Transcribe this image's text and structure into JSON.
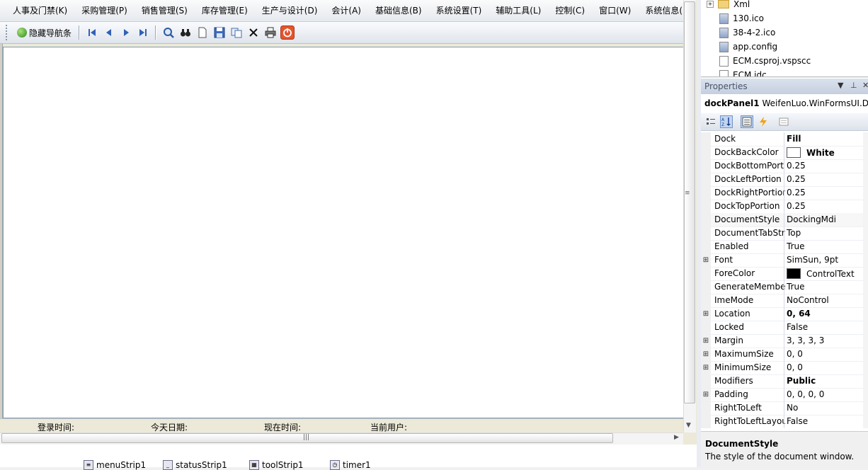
{
  "menu": [
    "人事及门禁(K)",
    "采购管理(P)",
    "销售管理(S)",
    "库存管理(E)",
    "生产与设计(D)",
    "会计(A)",
    "基础信息(B)",
    "系统设置(T)",
    "辅助工具(L)",
    "控制(C)",
    "窗口(W)",
    "系统信息(H)"
  ],
  "toolbar": {
    "nav_toggle_label": "隐藏导航条",
    "buttons": [
      "first-icon",
      "previous-icon",
      "next-icon",
      "last-icon",
      "preview-icon",
      "find-icon",
      "new-icon",
      "save-icon",
      "copy-icon",
      "delete-icon",
      "print-icon",
      "exit-icon"
    ]
  },
  "status": {
    "login_time": "登录时间:",
    "today_date": "今天日期:",
    "current_time": "现在时间:",
    "current_user": "当前用户:"
  },
  "tray": [
    "menuStrip1",
    "statusStrip1",
    "toolStrip1",
    "timer1"
  ],
  "solution_tree": [
    {
      "label": "Xml",
      "icon": "folder-icon"
    },
    {
      "label": "130.ico",
      "icon": "ico-file-icon"
    },
    {
      "label": "38-4-2.ico",
      "icon": "ico-file-icon"
    },
    {
      "label": "app.config",
      "icon": "config-file-icon"
    },
    {
      "label": "ECM.csproj.vspscc",
      "icon": "file-icon"
    },
    {
      "label": "ECM.idc",
      "icon": "file-icon"
    }
  ],
  "properties": {
    "title": "Properties",
    "object_name": "dockPanel1",
    "object_type": "WeifenLuo.WinFormsUI.Dc",
    "rows": [
      {
        "name": "Dock",
        "value": "Fill",
        "bold": true
      },
      {
        "name": "DockBackColor",
        "value": "White",
        "bold": true,
        "swatch": "#ffffff"
      },
      {
        "name": "DockBottomPort",
        "value": "0.25"
      },
      {
        "name": "DockLeftPortion",
        "value": "0.25"
      },
      {
        "name": "DockRightPortion",
        "value": "0.25"
      },
      {
        "name": "DockTopPortion",
        "value": "0.25"
      },
      {
        "name": "DocumentStyle",
        "value": "DockingMdi",
        "selected": true
      },
      {
        "name": "DocumentTabStr",
        "value": "Top"
      },
      {
        "name": "Enabled",
        "value": "True"
      },
      {
        "name": "Font",
        "value": "SimSun, 9pt",
        "expandable": true
      },
      {
        "name": "ForeColor",
        "value": "ControlText",
        "swatch": "#000000"
      },
      {
        "name": "GenerateMembe",
        "value": "True"
      },
      {
        "name": "ImeMode",
        "value": "NoControl"
      },
      {
        "name": "Location",
        "value": "0, 64",
        "bold": true,
        "expandable": true
      },
      {
        "name": "Locked",
        "value": "False"
      },
      {
        "name": "Margin",
        "value": "3, 3, 3, 3",
        "expandable": true
      },
      {
        "name": "MaximumSize",
        "value": "0, 0",
        "expandable": true
      },
      {
        "name": "MinimumSize",
        "value": "0, 0",
        "expandable": true
      },
      {
        "name": "Modifiers",
        "value": "Public",
        "bold": true
      },
      {
        "name": "Padding",
        "value": "0, 0, 0, 0",
        "expandable": true
      },
      {
        "name": "RightToLeft",
        "value": "No"
      },
      {
        "name": "RightToLeftLayou",
        "value": "False"
      }
    ],
    "description_title": "DocumentStyle",
    "description_text": "The style of the document window."
  }
}
